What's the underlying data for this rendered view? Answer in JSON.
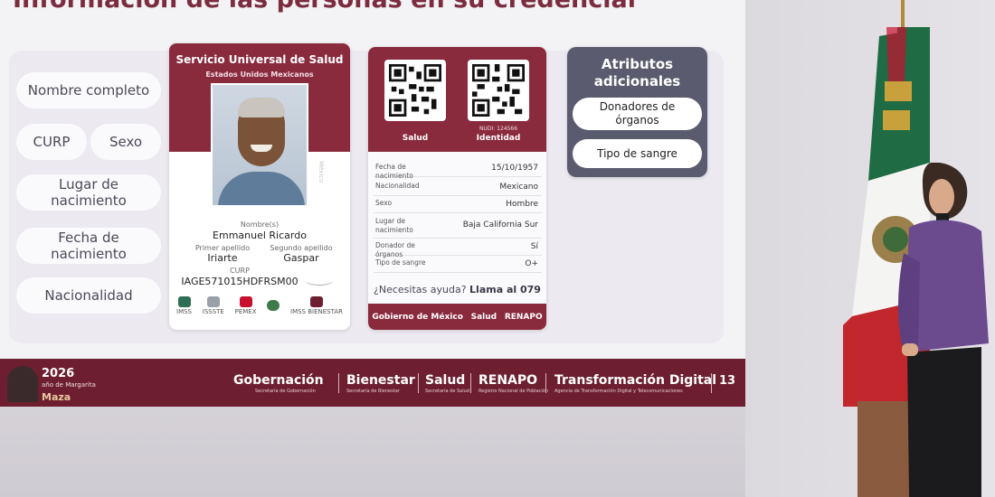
{
  "headline": "Información de las personas en su credencial",
  "fields": [
    "Nombre completo",
    "CURP",
    "Sexo",
    "Lugar de nacimiento",
    "Fecha de nacimiento",
    "Nacionalidad"
  ],
  "card_front": {
    "title": "Servicio Universal de Salud",
    "subtitle": "Estados Unidos Mexicanos",
    "vertical_text": "México",
    "name_label": "Nombre(s)",
    "name_value": "Emmanuel Ricardo",
    "first_surname_label": "Primer apellido",
    "first_surname_value": "Iriarte",
    "second_surname_label": "Segundo apellido",
    "second_surname_value": "Gaspar",
    "curp_label": "CURP",
    "curp_value": "IAGE571015HDFRSM00",
    "logos": [
      "IMSS",
      "ISSSTE",
      "PEMEX",
      "",
      "IMSS BIENESTAR"
    ]
  },
  "card_back": {
    "qr_left_label": "Salud",
    "qr_right_label": "Identidad",
    "nudi": "NUDI: 124566",
    "rows": [
      {
        "k": "Fecha de nacimiento",
        "v": "15/10/1957"
      },
      {
        "k": "Nacionalidad",
        "v": "Mexicano"
      },
      {
        "k": "Sexo",
        "v": "Hombre"
      },
      {
        "k": "Lugar de nacimiento",
        "v": "Baja California Sur"
      },
      {
        "k": "Donador de órganos",
        "v": "Sí"
      },
      {
        "k": "Tipo de sangre",
        "v": "O+"
      }
    ],
    "help_text": "¿Necesitas ayuda?",
    "help_bold": "Llama al 079",
    "footer": [
      "Gobierno de México",
      "Salud",
      "RENAPO"
    ]
  },
  "attributes": {
    "title": "Atributos adicionales",
    "items": [
      "Donadores de órganos",
      "Tipo de sangre"
    ]
  },
  "bottom_bar": {
    "year": "2026",
    "year_sub": "año de Margarita",
    "year_name": "Maza",
    "orgs": [
      "Gobernación",
      "Bienestar",
      "Salud",
      "RENAPO",
      "Transformación Digital"
    ],
    "orgs_sub": [
      "Secretaría de Gobernación",
      "Secretaría de Bienestar",
      "Secretaría de Salud",
      "Registro Nacional de Población",
      "Agencia de Transformación Digital y Telecomunicaciones"
    ],
    "page": "13"
  },
  "colors": {
    "guinda": "#8a2a3d",
    "bar": "#6e1f2f",
    "panel": "#5a5b6e"
  }
}
